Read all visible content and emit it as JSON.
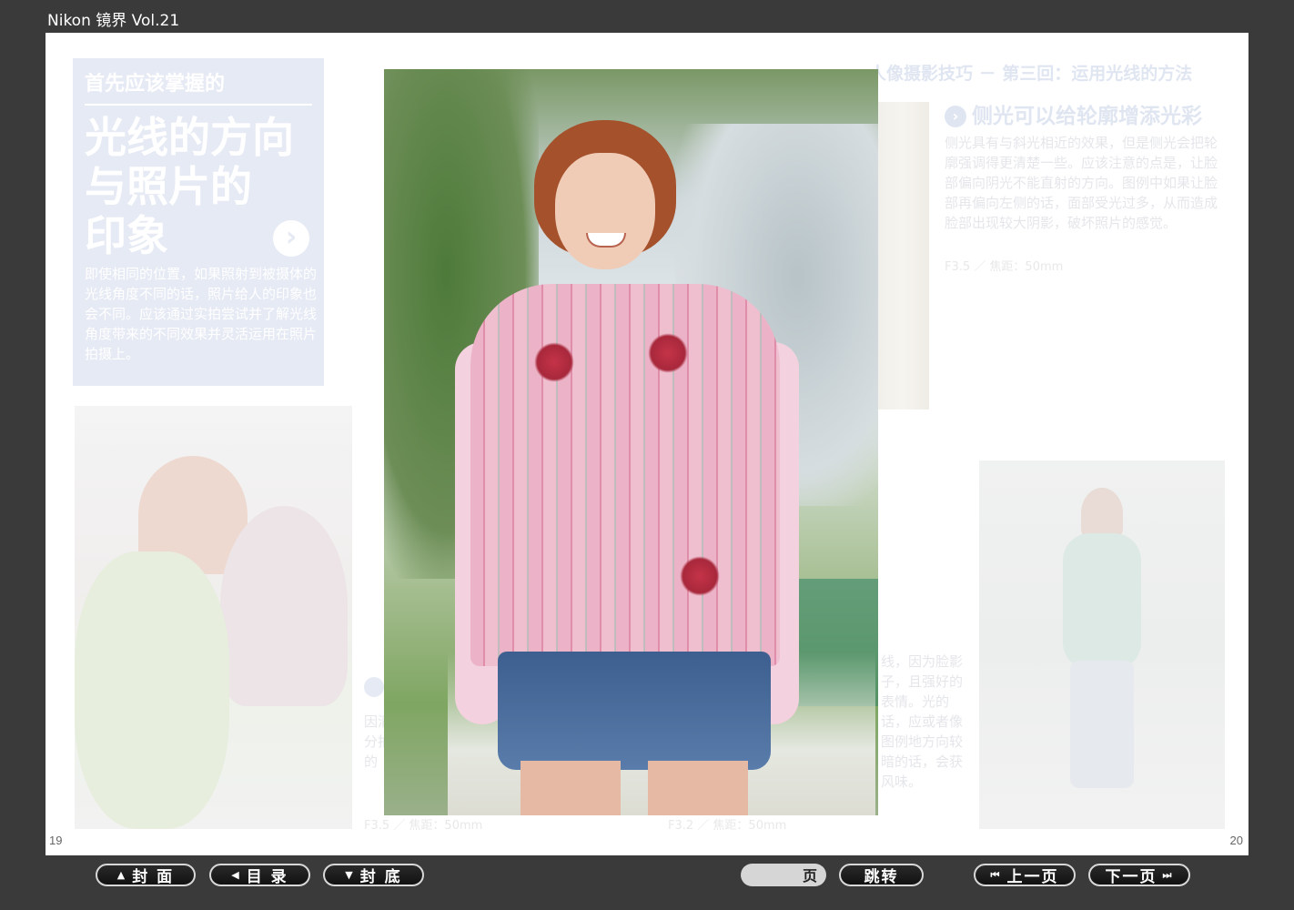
{
  "window": {
    "title": "Nikon 镜界 Vol.21"
  },
  "pages": {
    "left_number": "19",
    "right_number": "20"
  },
  "intro": {
    "kicker": "首先应该掌握的",
    "heading_lines": [
      "光线的方向",
      "与照片的",
      "印象"
    ],
    "arrow": "›",
    "body": "即使相同的位置，如果照射到被摄体的光线角度不同的话，照片给人的印象也会不同。应该通过实拍尝试并了解光线角度带来的不同效果并灵活运用在照片拍摄上。"
  },
  "right_page": {
    "series_title": "人像摄影技巧 － 第三回：运用光线的方法",
    "section_icon": "›",
    "section_heading": "侧光可以给轮廓增添光彩",
    "section_body": "侧光具有与斜光相近的效果，但是侧光会把轮廓强调得更清楚一些。应该注意的点是，让脸部偏向阴光不能直射的方向。图例中如果让脸部再偏向左侧的话，面部受光过多，从而造成脸部出现较大阴影，破坏照片的感觉。",
    "section_meta": "F3.5 ／ 焦距：50mm",
    "lower_text": "线，因为脸影子，且强好的表情。光的话，应或者像图例地方向较暗的话，会获风味。"
  },
  "left_page_lower": {
    "text": "因清分拍的",
    "meta_1": "F3.5 ／ 焦距：50mm",
    "meta_2": "F3.2 ／ 焦距：50mm"
  },
  "nav": {
    "cover": "封 面",
    "toc": "目 录",
    "back_cover": "封 底",
    "page_suffix": "页",
    "jump": "跳转",
    "prev": "上一页",
    "next": "下一页"
  },
  "icons": {
    "cover": "up-triangle-icon",
    "toc": "left-triangle-icon",
    "back_cover": "down-triangle-icon",
    "prev": "skip-back-icon",
    "next": "skip-forward-icon"
  }
}
